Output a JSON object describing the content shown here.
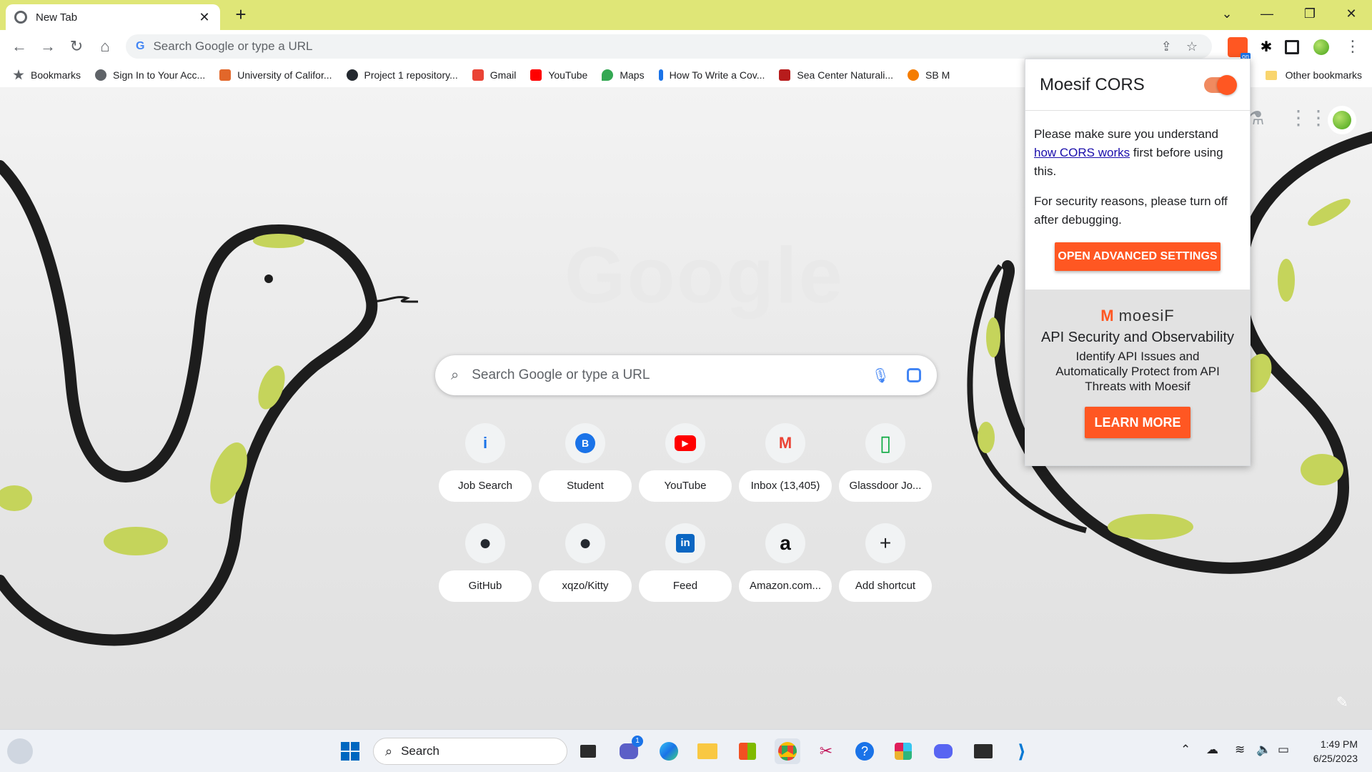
{
  "window": {
    "tab_title": "New Tab",
    "tab_close": "✕",
    "new_tab": "+",
    "controls": [
      "⌄",
      "—",
      "❐",
      "✕"
    ]
  },
  "toolbar": {
    "back": "←",
    "forward": "→",
    "reload": "↻",
    "home": "⌂",
    "omnibox_placeholder": "Search Google or type a URL",
    "share": "⇪",
    "star": "☆",
    "menu": "⋮"
  },
  "bookmarks": {
    "items": [
      {
        "label": "Bookmarks",
        "color": "#5f6368"
      },
      {
        "label": "Sign In to Your Acc...",
        "color": "#5f6368"
      },
      {
        "label": "University of Califor...",
        "color": "#e2672a"
      },
      {
        "label": "Project 1 repository...",
        "color": "#24292f"
      },
      {
        "label": "Gmail",
        "color": "#ea4335"
      },
      {
        "label": "YouTube",
        "color": "#ff0000"
      },
      {
        "label": "Maps",
        "color": "#34a853"
      },
      {
        "label": "How To Write a Cov...",
        "color": "#1a73e8"
      },
      {
        "label": "Sea Center Naturali...",
        "color": "#b71c1c"
      },
      {
        "label": "SB M",
        "color": "#f57c00"
      }
    ],
    "other": "Other bookmarks"
  },
  "ntp": {
    "logo": "Google",
    "search_placeholder": "Search Google or type a URL",
    "shortcuts": [
      {
        "label": "Job Search",
        "glyph": "i",
        "color": "#1a73e8"
      },
      {
        "label": "Student",
        "glyph": "B",
        "color": "#ffffff"
      },
      {
        "label": "YouTube",
        "glyph": "▶",
        "color": "#ff0000"
      },
      {
        "label": "Inbox (13,405)",
        "glyph": "M",
        "color": "#ea4335"
      },
      {
        "label": "Glassdoor Jo...",
        "glyph": "▯",
        "color": "#0caa41"
      },
      {
        "label": "GitHub",
        "glyph": "●",
        "color": "#24292f"
      },
      {
        "label": "xqzo/Kitty",
        "glyph": "●",
        "color": "#24292f"
      },
      {
        "label": "Feed",
        "glyph": "in",
        "color": "#0a66c2"
      },
      {
        "label": "Amazon.com...",
        "glyph": "a",
        "color": "#111111"
      },
      {
        "label": "Add shortcut",
        "glyph": "+",
        "color": "#202124"
      }
    ]
  },
  "popup": {
    "title": "Moesif CORS",
    "toggle_on": true,
    "para1_before": "Please make sure you understand ",
    "para1_link": "how CORS works",
    "para1_after": " first before using this.",
    "para2": "For security reasons, please turn off after debugging.",
    "advanced_button": "OPEN ADVANCED SETTINGS",
    "brand": "moesiF",
    "promo_title": "API Security and Observability",
    "promo_text": "Identify API Issues and Automatically Protect from API Threats with Moesif",
    "learn_more": "LEARN MORE",
    "accent": "#ff5722"
  },
  "taskbar": {
    "search_label": "Search",
    "chat_badge": "1",
    "time": "1:49 PM",
    "date": "6/25/2023"
  }
}
